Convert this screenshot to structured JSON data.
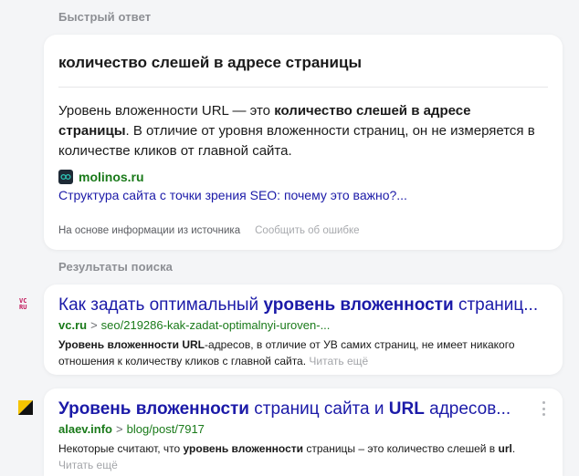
{
  "quick_answer": {
    "label": "Быстрый ответ",
    "title": "количество слешей в адресе страницы",
    "text_part1": "Уровень вложенности URL — это ",
    "text_bold": "количество слешей в адресе страницы",
    "text_part2": ". В отличие от уровня вложенности страниц, он не измеряется в количестве кликов от главной сайта.",
    "source_domain": "molinos.ru",
    "source_link": "Структура сайта с точки зрения SEO: почему это важно?...",
    "footer_basis": "На основе информации из источника",
    "footer_report": "Сообщить об ошибке"
  },
  "results": {
    "label": "Результаты поиска",
    "items": [
      {
        "title_pre": "Как задать оптимальный ",
        "title_bold": "уровень вложенности",
        "title_post": " страниц...",
        "domain": "vc.ru",
        "separator": ">",
        "path": "seo/219286-kak-zadat-optimalnyi-uroven-...",
        "snippet_bold": "Уровень вложенности URL",
        "snippet_text": "-адресов, в отличие от УВ самих страниц, не имеет никакого отношения к количеству кликов с главной сайта.",
        "more": "Читать ещё"
      },
      {
        "title_bold1": "Уровень вложенности",
        "title_mid": " страниц сайта и ",
        "title_bold2": "URL",
        "title_post": " адресов...",
        "domain": "alaev.info",
        "separator": ">",
        "path": "blog/post/7917",
        "snippet_pre": "Некоторые считают, что ",
        "snippet_bold1": "уровень вложенности",
        "snippet_mid": " страницы – это количество слешей в ",
        "snippet_bold2": "url",
        "snippet_end": ".",
        "more": "Читать ещё"
      }
    ]
  },
  "icons": {
    "vc_favicon": "vc-logo-icon",
    "alaev_favicon": "alaev-logo-icon",
    "molinos_favicon": "molinos-logo-icon",
    "menu": "more-vertical-icon"
  },
  "colors": {
    "link": "#1b1aa8",
    "url_green": "#1a7a1a",
    "muted": "#8d8f94",
    "background": "#f4f5f7"
  }
}
